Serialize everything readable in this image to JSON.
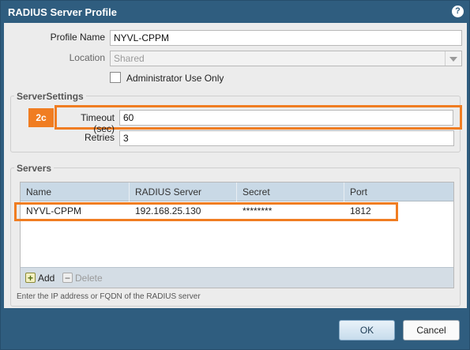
{
  "dialog": {
    "title": "RADIUS Server Profile",
    "help_icon": "?"
  },
  "form": {
    "profile_name_label": "Profile Name",
    "profile_name_value": "NYVL-CPPM",
    "location_label": "Location",
    "location_value": "Shared",
    "admin_use_label": "Administrator Use Only"
  },
  "server_settings": {
    "legend": "ServerSettings",
    "badge": "2c",
    "timeout_label": "Timeout (sec)",
    "timeout_value": "60",
    "retries_label": "Retries",
    "retries_value": "3"
  },
  "servers": {
    "legend": "Servers",
    "columns": [
      "Name",
      "RADIUS Server",
      "Secret",
      "Port"
    ],
    "rows": [
      {
        "name": "NYVL-CPPM",
        "server": "192.168.25.130",
        "secret": "********",
        "port": "1812"
      }
    ],
    "add_label": "Add",
    "delete_label": "Delete",
    "hint": "Enter the IP address or FQDN of the RADIUS server"
  },
  "buttons": {
    "ok": "OK",
    "cancel": "Cancel"
  },
  "colors": {
    "titlebar": "#2f5d7f",
    "highlight": "#f07d22"
  }
}
